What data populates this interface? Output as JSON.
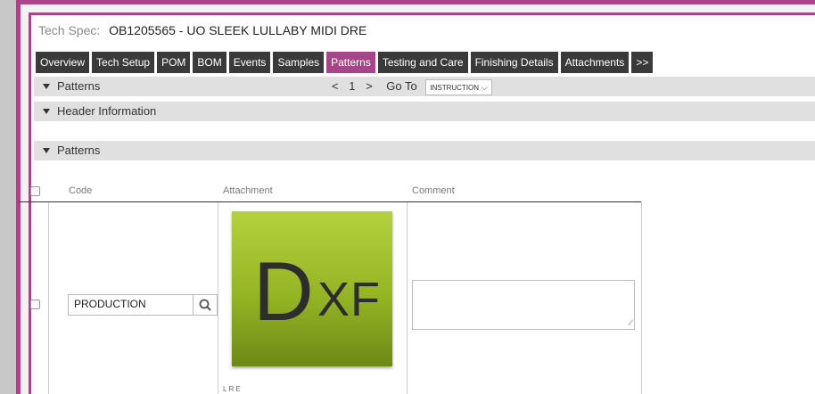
{
  "title": {
    "label": "Tech Spec:",
    "value": "OB1205565 - UO SLEEK LULLABY MIDI DRE"
  },
  "tabs": [
    {
      "label": "Overview"
    },
    {
      "label": "Tech Setup"
    },
    {
      "label": "POM"
    },
    {
      "label": "BOM"
    },
    {
      "label": "Events"
    },
    {
      "label": "Samples"
    },
    {
      "label": "Patterns"
    },
    {
      "label": "Testing and Care"
    },
    {
      "label": "Finishing Details"
    },
    {
      "label": "Attachments"
    },
    {
      "label": ">>"
    }
  ],
  "active_tab": "Patterns",
  "pager_section": {
    "label": "Patterns",
    "prev": "<",
    "page": "1",
    "next": ">",
    "goto_label": "Go To",
    "goto_value": "INSTRUCTION"
  },
  "header_section": {
    "label": "Header Information"
  },
  "patterns_section": {
    "label": "Patterns"
  },
  "table": {
    "columns": [
      "Code",
      "Attachment",
      "Comment"
    ],
    "rows": [
      {
        "code": "PRODUCTION",
        "attachment_text_top": "D",
        "attachment_text_bottom": "XF",
        "attachment_caption": "LRE",
        "comment": ""
      }
    ]
  },
  "colors": {
    "accent": "#a8458a",
    "tab_bg": "#3a3a3a",
    "section_bg": "#e0e0e0"
  },
  "icons": {
    "search": "search-icon",
    "collapse": "caret-down-icon"
  }
}
